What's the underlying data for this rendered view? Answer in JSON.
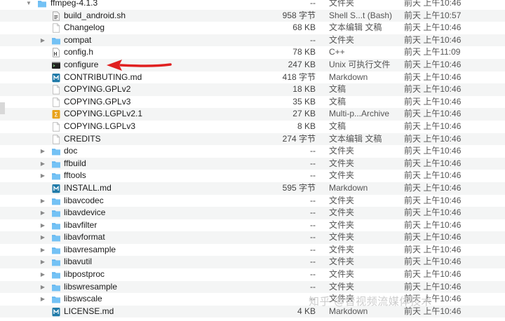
{
  "files": [
    {
      "name": "ffmpeg-4.1.3",
      "size": "--",
      "kind": "文件夹",
      "date": "前天 上午10:46",
      "icon": "folder-icon",
      "level": 0,
      "expanded": true
    },
    {
      "name": "build_android.sh",
      "size": "958 字节",
      "kind": "Shell S...t (Bash)",
      "date": "前天 上午10:57",
      "icon": "script-file-icon",
      "level": 1
    },
    {
      "name": "Changelog",
      "size": "68 KB",
      "kind": "文本编辑 文稿",
      "date": "前天 上午10:46",
      "icon": "document-icon",
      "level": 1
    },
    {
      "name": "compat",
      "size": "--",
      "kind": "文件夹",
      "date": "前天 上午10:46",
      "icon": "folder-icon",
      "level": 1,
      "collapsed": true
    },
    {
      "name": "config.h",
      "size": "78 KB",
      "kind": "C++",
      "date": "前天 上午11:09",
      "icon": "header-file-icon",
      "level": 1
    },
    {
      "name": "configure",
      "size": "247 KB",
      "kind": "Unix 可执行文件",
      "date": "前天 上午10:46",
      "icon": "terminal-executable-icon",
      "level": 1
    },
    {
      "name": "CONTRIBUTING.md",
      "size": "418 字节",
      "kind": "Markdown",
      "date": "前天 上午10:46",
      "icon": "markdown-file-icon",
      "level": 1
    },
    {
      "name": "COPYING.GPLv2",
      "size": "18 KB",
      "kind": "文稿",
      "date": "前天 上午10:46",
      "icon": "document-icon",
      "level": 1
    },
    {
      "name": "COPYING.GPLv3",
      "size": "35 KB",
      "kind": "文稿",
      "date": "前天 上午10:46",
      "icon": "document-icon",
      "level": 1
    },
    {
      "name": "COPYING.LGPLv2.1",
      "size": "27 KB",
      "kind": "Multi-p...Archive",
      "date": "前天 上午10:46",
      "icon": "archive-file-icon",
      "level": 1
    },
    {
      "name": "COPYING.LGPLv3",
      "size": "8 KB",
      "kind": "文稿",
      "date": "前天 上午10:46",
      "icon": "document-icon",
      "level": 1
    },
    {
      "name": "CREDITS",
      "size": "274 字节",
      "kind": "文本编辑 文稿",
      "date": "前天 上午10:46",
      "icon": "document-icon",
      "level": 1
    },
    {
      "name": "doc",
      "size": "--",
      "kind": "文件夹",
      "date": "前天 上午10:46",
      "icon": "folder-icon",
      "level": 1,
      "collapsed": true
    },
    {
      "name": "ffbuild",
      "size": "--",
      "kind": "文件夹",
      "date": "前天 上午10:46",
      "icon": "folder-icon",
      "level": 1,
      "collapsed": true
    },
    {
      "name": "fftools",
      "size": "--",
      "kind": "文件夹",
      "date": "前天 上午10:46",
      "icon": "folder-icon",
      "level": 1,
      "collapsed": true
    },
    {
      "name": "INSTALL.md",
      "size": "595 字节",
      "kind": "Markdown",
      "date": "前天 上午10:46",
      "icon": "markdown-file-icon",
      "level": 1
    },
    {
      "name": "libavcodec",
      "size": "--",
      "kind": "文件夹",
      "date": "前天 上午10:46",
      "icon": "folder-icon",
      "level": 1,
      "collapsed": true
    },
    {
      "name": "libavdevice",
      "size": "--",
      "kind": "文件夹",
      "date": "前天 上午10:46",
      "icon": "folder-icon",
      "level": 1,
      "collapsed": true
    },
    {
      "name": "libavfilter",
      "size": "--",
      "kind": "文件夹",
      "date": "前天 上午10:46",
      "icon": "folder-icon",
      "level": 1,
      "collapsed": true
    },
    {
      "name": "libavformat",
      "size": "--",
      "kind": "文件夹",
      "date": "前天 上午10:46",
      "icon": "folder-icon",
      "level": 1,
      "collapsed": true
    },
    {
      "name": "libavresample",
      "size": "--",
      "kind": "文件夹",
      "date": "前天 上午10:46",
      "icon": "folder-icon",
      "level": 1,
      "collapsed": true
    },
    {
      "name": "libavutil",
      "size": "--",
      "kind": "文件夹",
      "date": "前天 上午10:46",
      "icon": "folder-icon",
      "level": 1,
      "collapsed": true
    },
    {
      "name": "libpostproc",
      "size": "--",
      "kind": "文件夹",
      "date": "前天 上午10:46",
      "icon": "folder-icon",
      "level": 1,
      "collapsed": true
    },
    {
      "name": "libswresample",
      "size": "--",
      "kind": "文件夹",
      "date": "前天 上午10:46",
      "icon": "folder-icon",
      "level": 1,
      "collapsed": true
    },
    {
      "name": "libswscale",
      "size": "--",
      "kind": "文件夹",
      "date": "前天 上午10:46",
      "icon": "folder-icon",
      "level": 1,
      "collapsed": true
    },
    {
      "name": "LICENSE.md",
      "size": "4 KB",
      "kind": "Markdown",
      "date": "前天 上午10:46",
      "icon": "markdown-file-icon",
      "level": 1
    }
  ],
  "annotation": {
    "target": "configure",
    "color": "#e02020",
    "icon": "red-arrow-icon"
  },
  "watermark": {
    "text": "知乎 @音视频流媒体技术"
  },
  "colors": {
    "folder": "#5fb4ef",
    "markdown": "#1f7aa8",
    "archive": "#e8a21c",
    "row_alt": "#f4f5f5"
  }
}
